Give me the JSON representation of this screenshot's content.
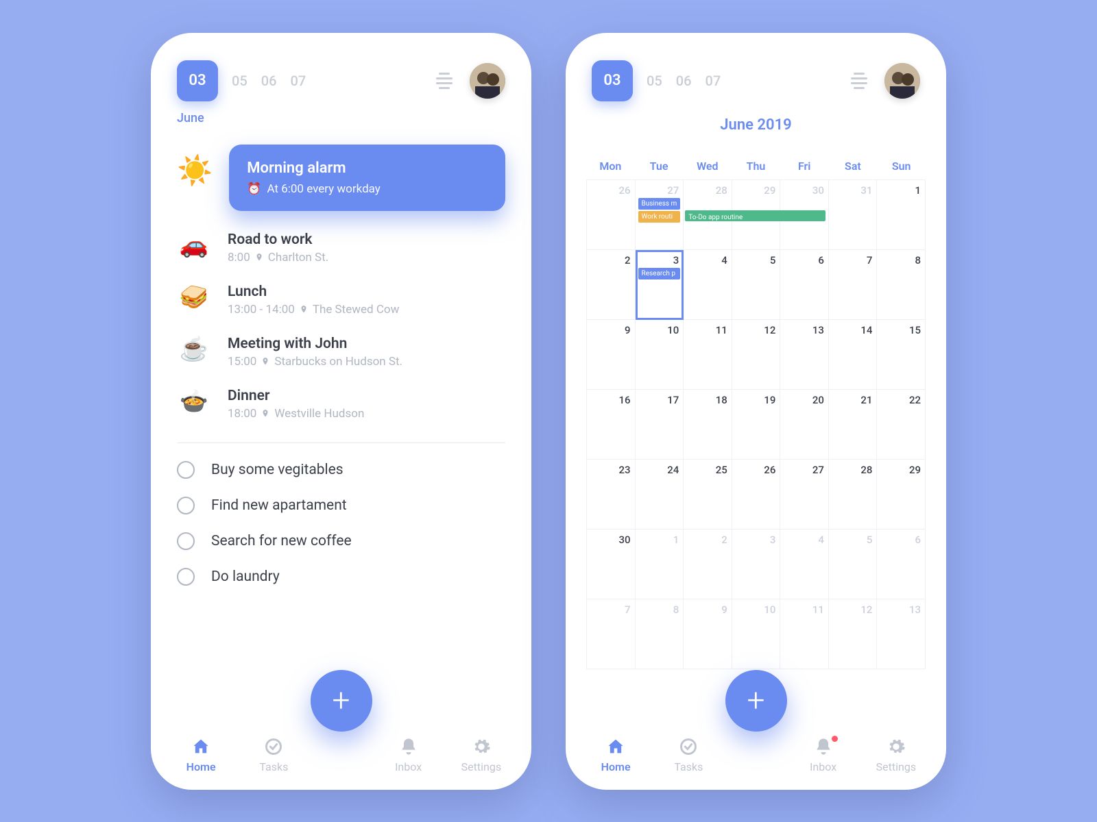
{
  "colors": {
    "accent": "#6a8bf0",
    "muted": "#c0c5d0",
    "badge": "#ff5a6a"
  },
  "header": {
    "selected_day": "03",
    "other_days": [
      "05",
      "06",
      "07"
    ],
    "month": "June"
  },
  "alarm": {
    "emoji": "☀️",
    "title": "Morning alarm",
    "subtitle": "At 6:00 every workday"
  },
  "events": [
    {
      "emoji": "🚗",
      "title": "Road to work",
      "time": "8:00",
      "place": "Charlton St."
    },
    {
      "emoji": "🥪",
      "title": "Lunch",
      "time": "13:00 - 14:00",
      "place": "The Stewed Cow"
    },
    {
      "emoji": "☕",
      "title": "Meeting with John",
      "time": "15:00",
      "place": "Starbucks on Hudson St."
    },
    {
      "emoji": "🍲",
      "title": "Dinner",
      "time": "18:00",
      "place": "Westville Hudson"
    }
  ],
  "todos": [
    "Buy some vegitables",
    "Find new apartament",
    "Search for new coffee",
    "Do laundry"
  ],
  "tabs": {
    "home": "Home",
    "tasks": "Tasks",
    "inbox": "Inbox",
    "settings": "Settings"
  },
  "calendar": {
    "title": "June 2019",
    "weekdays": [
      "Mon",
      "Tue",
      "Wed",
      "Thu",
      "Fri",
      "Sat",
      "Sun"
    ],
    "events": {
      "row0": {
        "business": "Business m",
        "work": "Work routi",
        "todo": "To-Do app routine"
      },
      "row1": {
        "research": "Research p"
      }
    },
    "days": [
      [
        {
          "n": "26",
          "dim": true
        },
        {
          "n": "27",
          "dim": true
        },
        {
          "n": "28",
          "dim": true
        },
        {
          "n": "29",
          "dim": true
        },
        {
          "n": "30",
          "dim": true
        },
        {
          "n": "31",
          "dim": true
        },
        {
          "n": "1"
        }
      ],
      [
        {
          "n": "2"
        },
        {
          "n": "3",
          "sel": true
        },
        {
          "n": "4"
        },
        {
          "n": "5"
        },
        {
          "n": "6"
        },
        {
          "n": "7"
        },
        {
          "n": "8"
        }
      ],
      [
        {
          "n": "9"
        },
        {
          "n": "10"
        },
        {
          "n": "11"
        },
        {
          "n": "12"
        },
        {
          "n": "13"
        },
        {
          "n": "14"
        },
        {
          "n": "15"
        }
      ],
      [
        {
          "n": "16"
        },
        {
          "n": "17"
        },
        {
          "n": "18"
        },
        {
          "n": "19"
        },
        {
          "n": "20"
        },
        {
          "n": "21"
        },
        {
          "n": "22"
        }
      ],
      [
        {
          "n": "23"
        },
        {
          "n": "24"
        },
        {
          "n": "25"
        },
        {
          "n": "26"
        },
        {
          "n": "27"
        },
        {
          "n": "28"
        },
        {
          "n": "29"
        }
      ],
      [
        {
          "n": "30"
        },
        {
          "n": "1",
          "dim": true
        },
        {
          "n": "2",
          "dim": true
        },
        {
          "n": "3",
          "dim": true
        },
        {
          "n": "4",
          "dim": true
        },
        {
          "n": "5",
          "dim": true
        },
        {
          "n": "6",
          "dim": true
        }
      ],
      [
        {
          "n": "7",
          "dim": true
        },
        {
          "n": "8",
          "dim": true
        },
        {
          "n": "9",
          "dim": true
        },
        {
          "n": "10",
          "dim": true
        },
        {
          "n": "11",
          "dim": true
        },
        {
          "n": "12",
          "dim": true
        },
        {
          "n": "13",
          "dim": true
        }
      ]
    ]
  }
}
